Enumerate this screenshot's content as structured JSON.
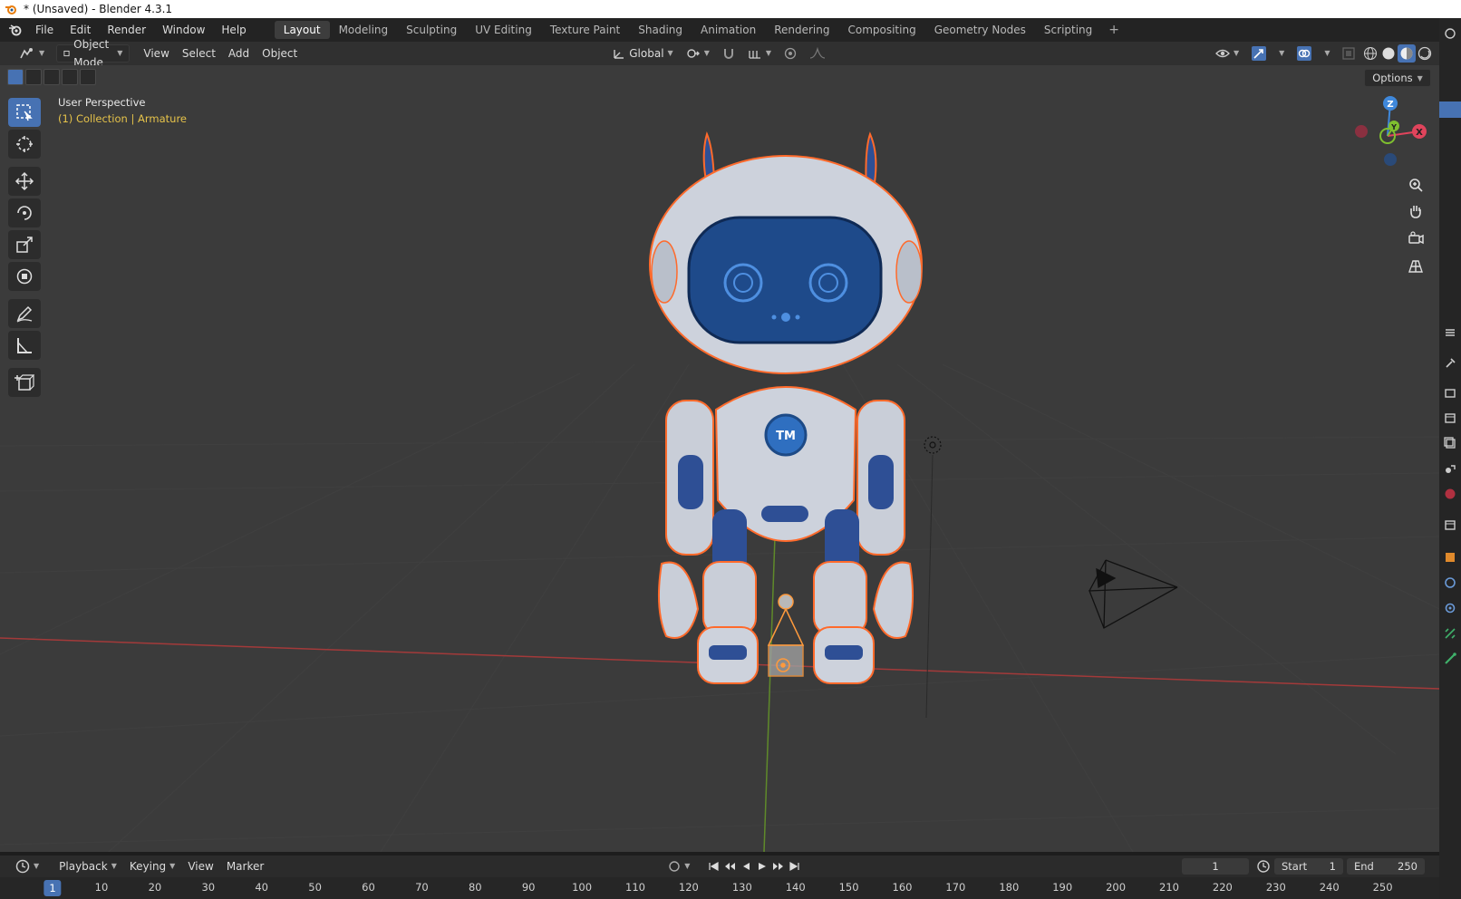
{
  "window": {
    "title": "* (Unsaved) - Blender 4.3.1"
  },
  "menu": [
    "File",
    "Edit",
    "Render",
    "Window",
    "Help"
  ],
  "workspaces": [
    "Layout",
    "Modeling",
    "Sculpting",
    "UV Editing",
    "Texture Paint",
    "Shading",
    "Animation",
    "Rendering",
    "Compositing",
    "Geometry Nodes",
    "Scripting"
  ],
  "active_workspace": "Layout",
  "viewport_header": {
    "mode": "Object Mode",
    "menus": [
      "View",
      "Select",
      "Add",
      "Object"
    ],
    "transform_orientation": "Global"
  },
  "viewport": {
    "view_name": "User Perspective",
    "context": "(1) Collection | Armature",
    "options_label": "Options",
    "emblem_text": "TM",
    "gizmo_axis_labels": {
      "z": "Z",
      "y": "Y",
      "x": "X"
    }
  },
  "timeline": {
    "menus": [
      "Playback",
      "Keying",
      "View",
      "Marker"
    ],
    "current_frame": "1",
    "start_label": "Start",
    "start_value": "1",
    "end_label": "End",
    "end_value": "250",
    "current_marker": "1",
    "ruler": [
      "10",
      "20",
      "30",
      "40",
      "50",
      "60",
      "70",
      "80",
      "90",
      "100",
      "110",
      "120",
      "130",
      "140",
      "150",
      "160",
      "170",
      "180",
      "190",
      "200",
      "210",
      "220",
      "230",
      "240",
      "250"
    ]
  },
  "colors": {
    "accent": "#4772b3",
    "selection_outline": "#ff6a2b",
    "context_text": "#e6c34a",
    "x_axis": "#e0445c",
    "y_axis": "#7fbf2f",
    "z_axis": "#3f88db"
  }
}
